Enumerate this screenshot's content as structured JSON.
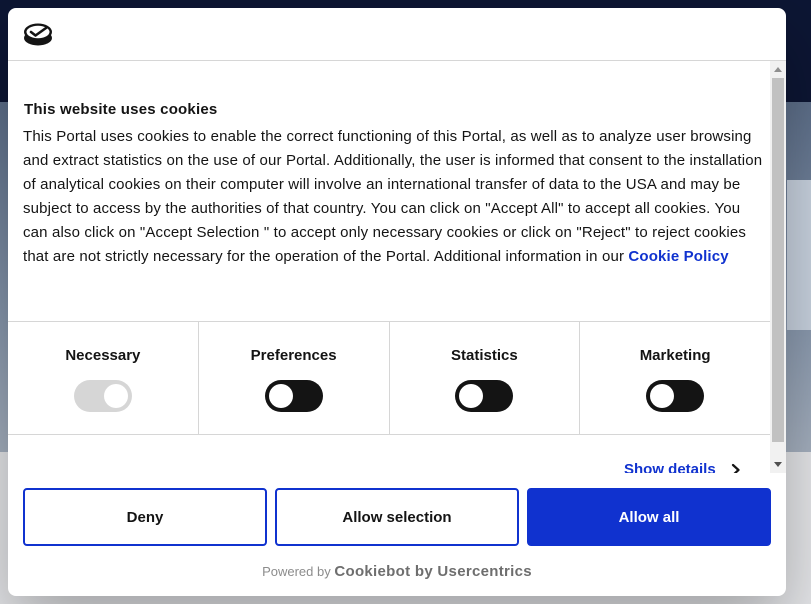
{
  "colors": {
    "accent": "#1032cf",
    "text": "#141414",
    "toggle_on": "#141414",
    "toggle_disabled": "#d6d6d6"
  },
  "dialog": {
    "logo_icon": "cookiebot-logo-icon",
    "title": "This website uses cookies",
    "body": "This Portal uses cookies to enable the correct functioning of this Portal, as well as to analyze user browsing and extract statistics on the use of our Portal. Additionally, the user is informed that consent to the installation of analytical cookies on their computer will involve an international transfer of data to the USA and may be subject to access by the authorities of that country. You can click on \"Accept All\" to accept all cookies. You can also click on \"Accept Selection \" to accept only necessary cookies or click on \"Reject\" to reject cookies that are not strictly necessary for the operation of the Portal. Additional information in our ",
    "cookie_policy_link": "Cookie Policy",
    "categories": [
      {
        "label": "Necessary",
        "enabled": false,
        "checked": true
      },
      {
        "label": "Preferences",
        "enabled": true,
        "checked": false
      },
      {
        "label": "Statistics",
        "enabled": true,
        "checked": false
      },
      {
        "label": "Marketing",
        "enabled": true,
        "checked": false
      }
    ],
    "show_details": "Show details",
    "buttons": {
      "deny": "Deny",
      "allow_selection": "Allow selection",
      "allow_all": "Allow all"
    },
    "powered_by": "Powered by",
    "brand": "Cookiebot by Usercentrics"
  }
}
